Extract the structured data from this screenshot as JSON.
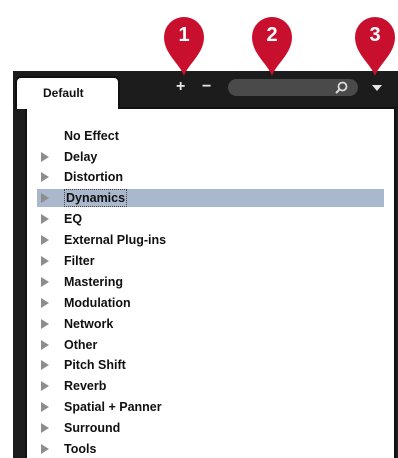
{
  "tab": {
    "label": "Default"
  },
  "toolbar": {
    "add_label": "+",
    "remove_label": "−"
  },
  "search": {
    "value": "",
    "placeholder": ""
  },
  "callouts": [
    "1",
    "2",
    "3"
  ],
  "list": {
    "items": [
      {
        "label": "No Effect",
        "has_children": false,
        "selected": false
      },
      {
        "label": "Delay",
        "has_children": true,
        "selected": false
      },
      {
        "label": "Distortion",
        "has_children": true,
        "selected": false
      },
      {
        "label": "Dynamics",
        "has_children": true,
        "selected": true
      },
      {
        "label": "EQ",
        "has_children": true,
        "selected": false
      },
      {
        "label": "External Plug-ins",
        "has_children": true,
        "selected": false
      },
      {
        "label": "Filter",
        "has_children": true,
        "selected": false
      },
      {
        "label": "Mastering",
        "has_children": true,
        "selected": false
      },
      {
        "label": "Modulation",
        "has_children": true,
        "selected": false
      },
      {
        "label": "Network",
        "has_children": true,
        "selected": false
      },
      {
        "label": "Other",
        "has_children": true,
        "selected": false
      },
      {
        "label": "Pitch Shift",
        "has_children": true,
        "selected": false
      },
      {
        "label": "Reverb",
        "has_children": true,
        "selected": false
      },
      {
        "label": "Spatial + Panner",
        "has_children": true,
        "selected": false
      },
      {
        "label": "Surround",
        "has_children": true,
        "selected": false
      },
      {
        "label": "Tools",
        "has_children": true,
        "selected": false
      }
    ]
  },
  "colors": {
    "callout": "#c8102e",
    "panel": "#1c1c1c",
    "selection": "#a9b8cc",
    "expand_arrow": "#8d8d8d"
  },
  "icons": {
    "search": "magnifier-icon",
    "dropdown": "triangle-down-icon",
    "expand": "triangle-right-icon"
  }
}
